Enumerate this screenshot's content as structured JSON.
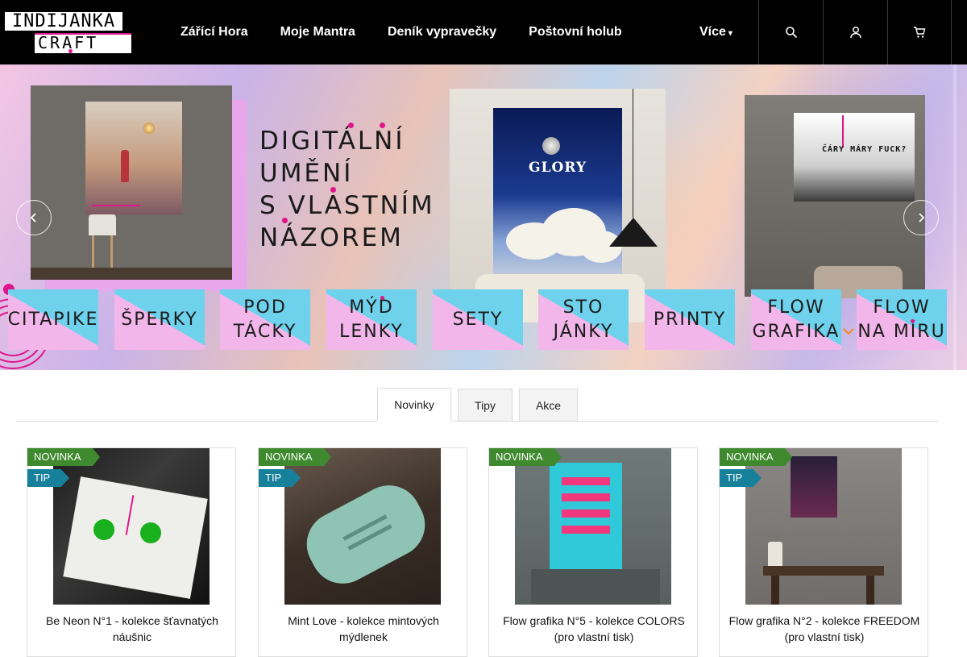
{
  "logo": {
    "line1": "INDIJANKA",
    "line2": "CRAFT"
  },
  "nav": {
    "items": [
      {
        "label": "Zářící Hora"
      },
      {
        "label": "Moje Mantra"
      },
      {
        "label": "Deník vypravečky"
      },
      {
        "label": "Poštovní holub"
      }
    ],
    "more_label": "Více",
    "more_icon": "chevron-down-icon"
  },
  "header_icons": [
    "search-icon",
    "user-icon",
    "cart-icon"
  ],
  "banner": {
    "headline": [
      "DIGITÁLNÍ",
      "UMĚNÍ",
      "S VLASTNÍM",
      "NÁZOREM"
    ],
    "poster_center_title": "GLORY",
    "poster_right_title": "ČÁRY MÁRY FUCK?",
    "categories": [
      {
        "label": [
          "CITAPIKE"
        ]
      },
      {
        "label": [
          "ŠPERKY"
        ]
      },
      {
        "label": [
          "POD",
          "TÁCKY"
        ]
      },
      {
        "label": [
          "MÝD",
          "LENKY"
        ]
      },
      {
        "label": [
          "SETY"
        ]
      },
      {
        "label": [
          "STO",
          "JÁNKY"
        ]
      },
      {
        "label": [
          "PRINTY"
        ]
      },
      {
        "label": [
          "FLOW",
          "GRAFIKA"
        ]
      },
      {
        "label": [
          "FLOW",
          "NA MÍRU"
        ]
      }
    ]
  },
  "tabs": [
    {
      "label": "Novinky",
      "active": true
    },
    {
      "label": "Tipy",
      "active": false
    },
    {
      "label": "Akce",
      "active": false
    }
  ],
  "products": [
    {
      "title": "Be Neon N°1 - kolekce šťavnatých náušnic",
      "badges": [
        "NOVINKA",
        "TIP"
      ]
    },
    {
      "title": "Mint Love - kolekce mintových mýdlenek",
      "badges": [
        "NOVINKA",
        "TIP"
      ]
    },
    {
      "title": "Flow grafika N°5 - kolekce COLORS (pro vlastní tisk)",
      "badges": [
        "NOVINKA"
      ]
    },
    {
      "title": "Flow grafika N°2 - kolekce FREEDOM (pro vlastní tisk)",
      "badges": [
        "NOVINKA",
        "TIP"
      ]
    }
  ],
  "colors": {
    "accent": "#e0158c",
    "badge_new": "#3f8a2e",
    "badge_tip": "#17809a",
    "tile_pink": "#f2b6ea",
    "tile_blue": "#6fd2ec"
  }
}
